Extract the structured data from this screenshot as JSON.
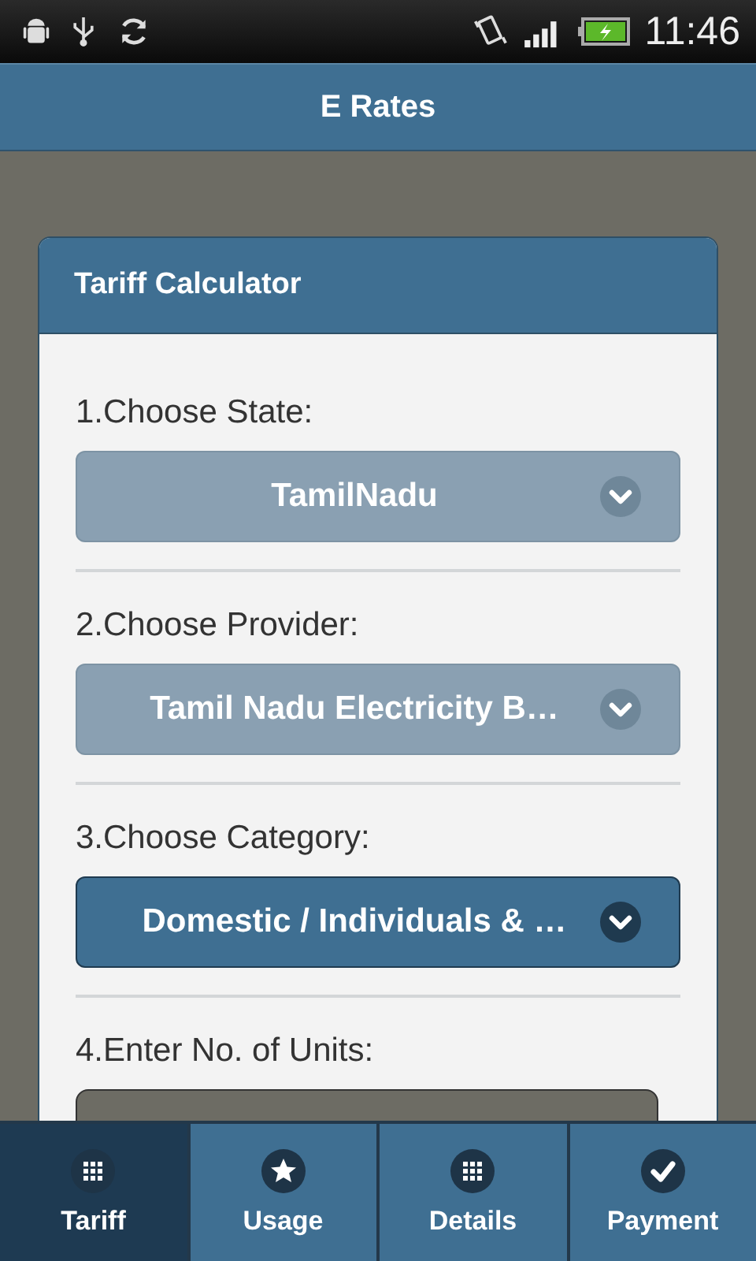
{
  "status_bar": {
    "time": "11:46"
  },
  "header": {
    "title": "E Rates"
  },
  "card": {
    "title": "Tariff Calculator",
    "fields": [
      {
        "kind": "select",
        "label": "1.Choose State:",
        "value": "TamilNadu",
        "disabled": true
      },
      {
        "kind": "select",
        "label": "2.Choose Provider:",
        "value": "Tamil Nadu Electricity B…",
        "disabled": true
      },
      {
        "kind": "select",
        "label": "3.Choose Category:",
        "value": "Domestic / Individuals & …",
        "disabled": false
      },
      {
        "kind": "input",
        "label": "4.Enter No. of Units:"
      }
    ]
  },
  "nav": [
    {
      "label": "Tariff",
      "kind": "grid",
      "selected": true
    },
    {
      "label": "Usage",
      "kind": "star",
      "selected": false
    },
    {
      "label": "Details",
      "kind": "grid",
      "selected": false
    },
    {
      "label": "Payment",
      "kind": "check",
      "selected": false
    }
  ]
}
